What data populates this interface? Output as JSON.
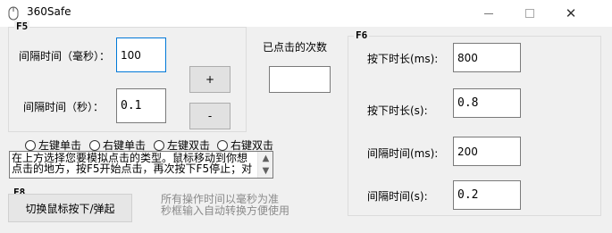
{
  "window": {
    "title": "360Safe"
  },
  "f5": {
    "label": "F5",
    "interval_ms_label": "间隔时间（毫秒）：",
    "interval_ms_value": "100",
    "interval_s_label": "间隔时间（秒）：",
    "interval_s_value": "0.1",
    "plus_label": "+",
    "minus_label": "-"
  },
  "click_count": {
    "label": "已点击的次数",
    "value": ""
  },
  "click_types": [
    "左键单击",
    "右键单击",
    "左键双击",
    "右键双击"
  ],
  "instructions": "在上方选择您要模拟点击的类型。鼠标移动到你想点击的地方，按F5开始点击，再次按下F5停止；对",
  "f8": {
    "label": "F8",
    "toggle_label": "切换鼠标按下/弹起"
  },
  "notes": {
    "line1": "所有操作时间以毫秒为准",
    "line2": "秒框输入自动转换方便使用"
  },
  "f6": {
    "label": "F6",
    "press_ms_label": "按下时长(ms):",
    "press_ms_value": "800",
    "press_s_label": "按下时长(s):",
    "press_s_value": "0.8",
    "interval_ms_label": "间隔时间(ms):",
    "interval_ms_value": "200",
    "interval_s_label": "间隔时间(s):",
    "interval_s_value": "0.2"
  },
  "icons": {
    "app": "mouse-icon",
    "scroll_up": "up-arrow-icon",
    "scroll_down": "down-arrow-icon"
  }
}
